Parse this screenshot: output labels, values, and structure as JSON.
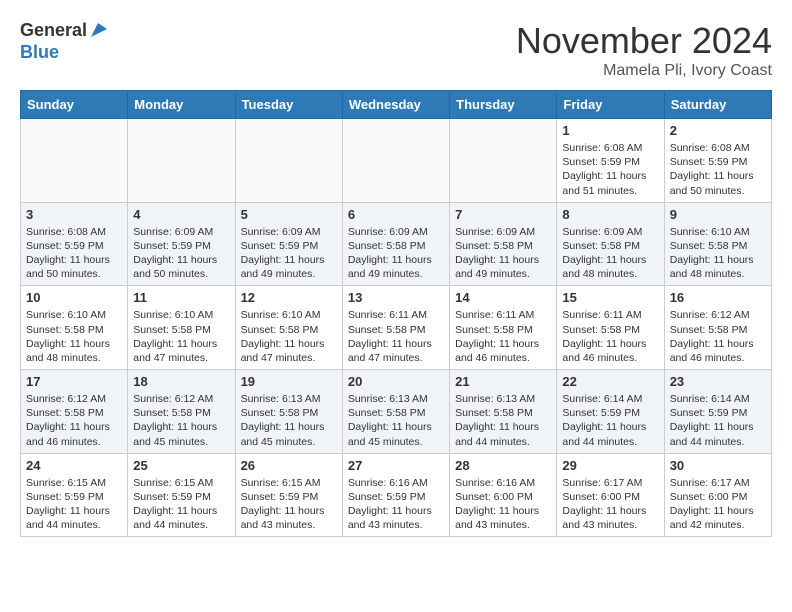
{
  "header": {
    "logo_line1": "General",
    "logo_line2": "Blue",
    "month": "November 2024",
    "location": "Mamela Pli, Ivory Coast"
  },
  "weekdays": [
    "Sunday",
    "Monday",
    "Tuesday",
    "Wednesday",
    "Thursday",
    "Friday",
    "Saturday"
  ],
  "weeks": [
    [
      {
        "day": "",
        "info": ""
      },
      {
        "day": "",
        "info": ""
      },
      {
        "day": "",
        "info": ""
      },
      {
        "day": "",
        "info": ""
      },
      {
        "day": "",
        "info": ""
      },
      {
        "day": "1",
        "info": "Sunrise: 6:08 AM\nSunset: 5:59 PM\nDaylight: 11 hours\nand 51 minutes."
      },
      {
        "day": "2",
        "info": "Sunrise: 6:08 AM\nSunset: 5:59 PM\nDaylight: 11 hours\nand 50 minutes."
      }
    ],
    [
      {
        "day": "3",
        "info": "Sunrise: 6:08 AM\nSunset: 5:59 PM\nDaylight: 11 hours\nand 50 minutes."
      },
      {
        "day": "4",
        "info": "Sunrise: 6:09 AM\nSunset: 5:59 PM\nDaylight: 11 hours\nand 50 minutes."
      },
      {
        "day": "5",
        "info": "Sunrise: 6:09 AM\nSunset: 5:59 PM\nDaylight: 11 hours\nand 49 minutes."
      },
      {
        "day": "6",
        "info": "Sunrise: 6:09 AM\nSunset: 5:58 PM\nDaylight: 11 hours\nand 49 minutes."
      },
      {
        "day": "7",
        "info": "Sunrise: 6:09 AM\nSunset: 5:58 PM\nDaylight: 11 hours\nand 49 minutes."
      },
      {
        "day": "8",
        "info": "Sunrise: 6:09 AM\nSunset: 5:58 PM\nDaylight: 11 hours\nand 48 minutes."
      },
      {
        "day": "9",
        "info": "Sunrise: 6:10 AM\nSunset: 5:58 PM\nDaylight: 11 hours\nand 48 minutes."
      }
    ],
    [
      {
        "day": "10",
        "info": "Sunrise: 6:10 AM\nSunset: 5:58 PM\nDaylight: 11 hours\nand 48 minutes."
      },
      {
        "day": "11",
        "info": "Sunrise: 6:10 AM\nSunset: 5:58 PM\nDaylight: 11 hours\nand 47 minutes."
      },
      {
        "day": "12",
        "info": "Sunrise: 6:10 AM\nSunset: 5:58 PM\nDaylight: 11 hours\nand 47 minutes."
      },
      {
        "day": "13",
        "info": "Sunrise: 6:11 AM\nSunset: 5:58 PM\nDaylight: 11 hours\nand 47 minutes."
      },
      {
        "day": "14",
        "info": "Sunrise: 6:11 AM\nSunset: 5:58 PM\nDaylight: 11 hours\nand 46 minutes."
      },
      {
        "day": "15",
        "info": "Sunrise: 6:11 AM\nSunset: 5:58 PM\nDaylight: 11 hours\nand 46 minutes."
      },
      {
        "day": "16",
        "info": "Sunrise: 6:12 AM\nSunset: 5:58 PM\nDaylight: 11 hours\nand 46 minutes."
      }
    ],
    [
      {
        "day": "17",
        "info": "Sunrise: 6:12 AM\nSunset: 5:58 PM\nDaylight: 11 hours\nand 46 minutes."
      },
      {
        "day": "18",
        "info": "Sunrise: 6:12 AM\nSunset: 5:58 PM\nDaylight: 11 hours\nand 45 minutes."
      },
      {
        "day": "19",
        "info": "Sunrise: 6:13 AM\nSunset: 5:58 PM\nDaylight: 11 hours\nand 45 minutes."
      },
      {
        "day": "20",
        "info": "Sunrise: 6:13 AM\nSunset: 5:58 PM\nDaylight: 11 hours\nand 45 minutes."
      },
      {
        "day": "21",
        "info": "Sunrise: 6:13 AM\nSunset: 5:58 PM\nDaylight: 11 hours\nand 44 minutes."
      },
      {
        "day": "22",
        "info": "Sunrise: 6:14 AM\nSunset: 5:59 PM\nDaylight: 11 hours\nand 44 minutes."
      },
      {
        "day": "23",
        "info": "Sunrise: 6:14 AM\nSunset: 5:59 PM\nDaylight: 11 hours\nand 44 minutes."
      }
    ],
    [
      {
        "day": "24",
        "info": "Sunrise: 6:15 AM\nSunset: 5:59 PM\nDaylight: 11 hours\nand 44 minutes."
      },
      {
        "day": "25",
        "info": "Sunrise: 6:15 AM\nSunset: 5:59 PM\nDaylight: 11 hours\nand 44 minutes."
      },
      {
        "day": "26",
        "info": "Sunrise: 6:15 AM\nSunset: 5:59 PM\nDaylight: 11 hours\nand 43 minutes."
      },
      {
        "day": "27",
        "info": "Sunrise: 6:16 AM\nSunset: 5:59 PM\nDaylight: 11 hours\nand 43 minutes."
      },
      {
        "day": "28",
        "info": "Sunrise: 6:16 AM\nSunset: 6:00 PM\nDaylight: 11 hours\nand 43 minutes."
      },
      {
        "day": "29",
        "info": "Sunrise: 6:17 AM\nSunset: 6:00 PM\nDaylight: 11 hours\nand 43 minutes."
      },
      {
        "day": "30",
        "info": "Sunrise: 6:17 AM\nSunset: 6:00 PM\nDaylight: 11 hours\nand 42 minutes."
      }
    ]
  ]
}
